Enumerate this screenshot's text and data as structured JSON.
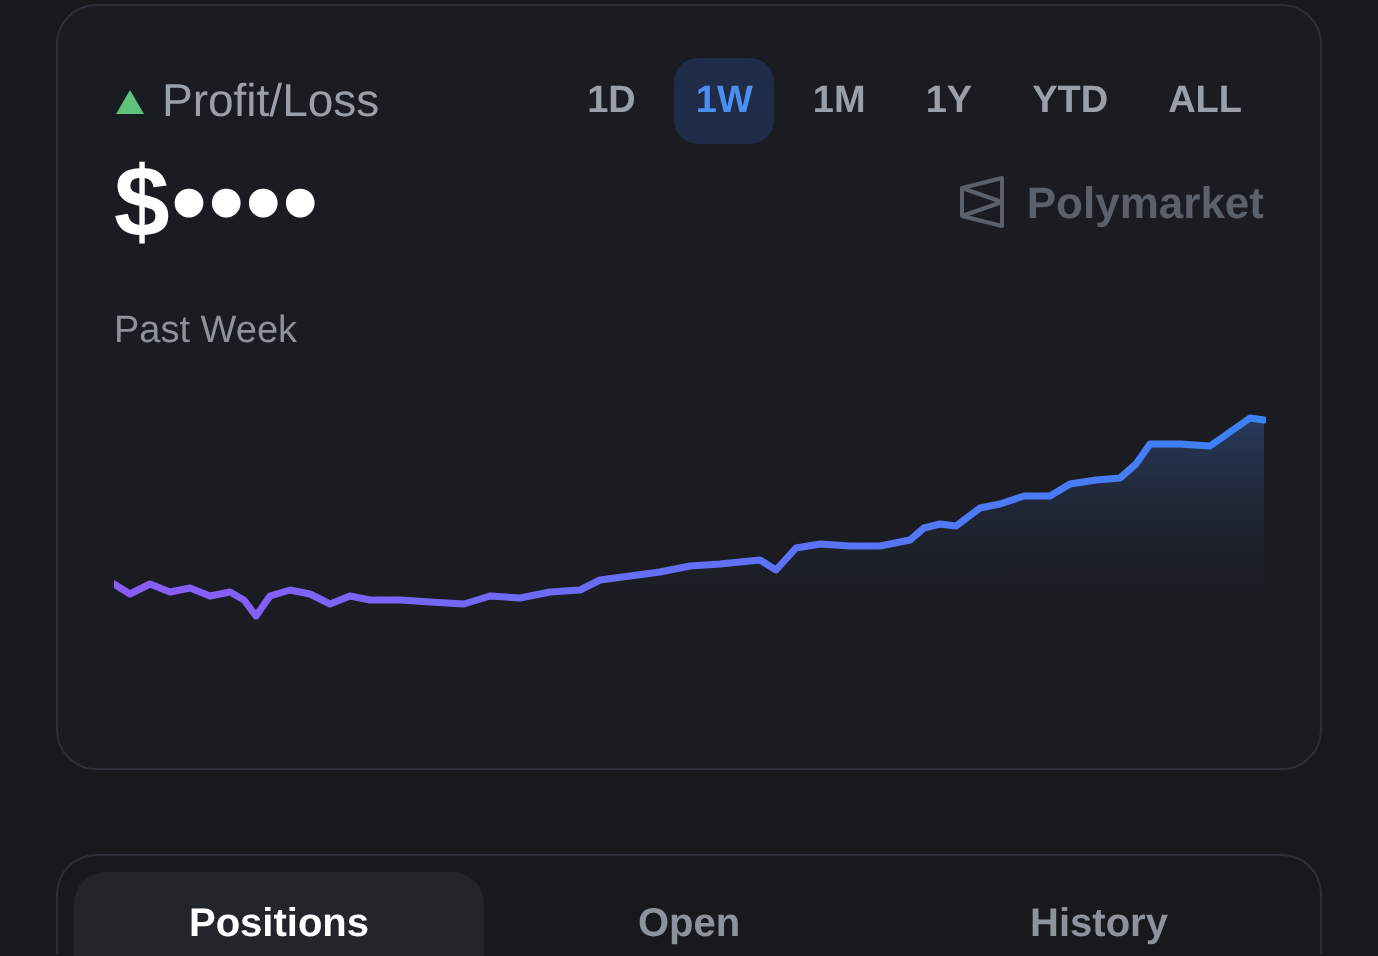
{
  "summary": {
    "trend_up": true,
    "title": "Profit/Loss",
    "value": "$••••",
    "period_label": "Past Week",
    "brand": "Polymarket"
  },
  "ranges": [
    {
      "label": "1D",
      "selected": false
    },
    {
      "label": "1W",
      "selected": true
    },
    {
      "label": "1M",
      "selected": false
    },
    {
      "label": "1Y",
      "selected": false
    },
    {
      "label": "YTD",
      "selected": false
    },
    {
      "label": "ALL",
      "selected": false
    }
  ],
  "tabs": [
    {
      "label": "Positions",
      "selected": true
    },
    {
      "label": "Open",
      "selected": false
    },
    {
      "label": "History",
      "selected": false
    }
  ]
}
